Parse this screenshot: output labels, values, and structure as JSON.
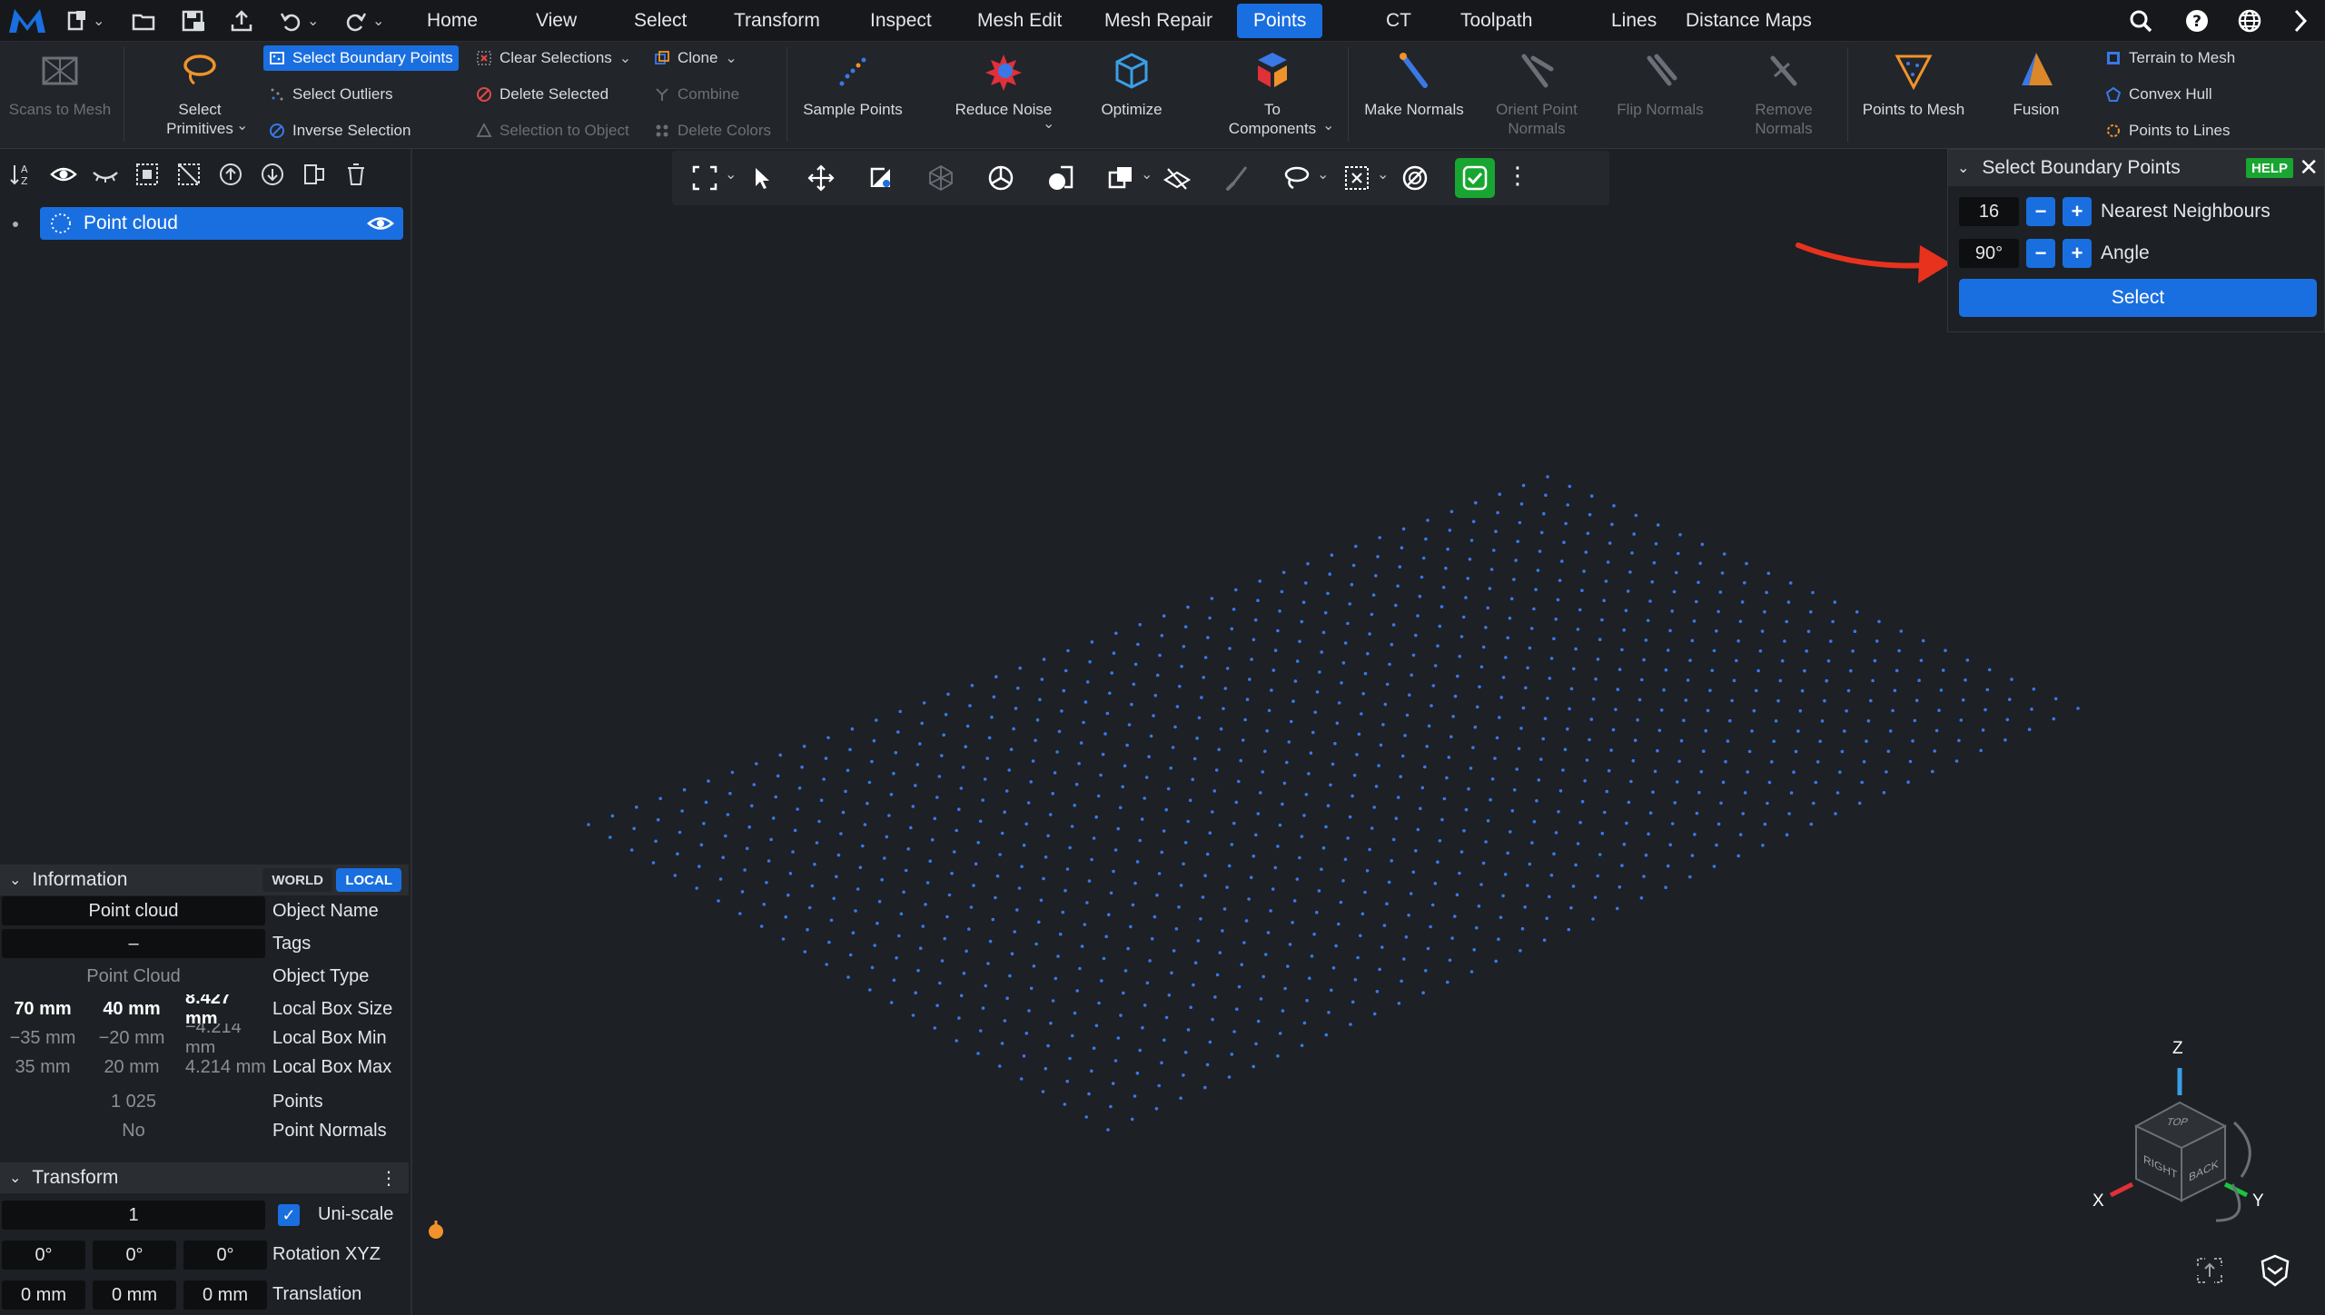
{
  "menubar": {
    "tabs": [
      "Home",
      "View",
      "Select",
      "Transform",
      "Inspect",
      "Mesh Edit",
      "Mesh Repair",
      "Points",
      "CT",
      "Toolpath",
      "Lines",
      "Distance Maps"
    ],
    "active_tab": "Points"
  },
  "ribbon": {
    "scans_to_mesh": "Scans to Mesh",
    "select_primitives": "Select Primitives",
    "select_boundary_points": "Select Boundary Points",
    "select_outliers": "Select Outliers",
    "inverse_selection": "Inverse Selection",
    "clear_selections": "Clear Selections",
    "delete_selected": "Delete Selected",
    "selection_to_object": "Selection to Object",
    "clone": "Clone",
    "combine": "Combine",
    "delete_colors": "Delete Colors",
    "sample_points": "Sample Points",
    "reduce_noise": "Reduce Noise",
    "optimize": "Optimize",
    "to_components": "To Components",
    "make_normals": "Make Normals",
    "orient_point_normals": "Orient Point Normals",
    "flip_normals": "Flip Normals",
    "remove_normals": "Remove Normals",
    "points_to_mesh": "Points to Mesh",
    "fusion": "Fusion",
    "terrain_to_mesh": "Terrain to Mesh",
    "convex_hull": "Convex Hull",
    "points_to_lines": "Points to Lines"
  },
  "scene": {
    "object_name": "Point cloud"
  },
  "information": {
    "title": "Information",
    "world": "WORLD",
    "local": "LOCAL",
    "object_name_value": "Point cloud",
    "object_name_label": "Object Name",
    "tags_value": "–",
    "tags_label": "Tags",
    "object_type_value": "Point Cloud",
    "object_type_label": "Object Type",
    "box_size": [
      "70 mm",
      "40 mm",
      "8.427 mm"
    ],
    "box_size_label": "Local Box Size",
    "box_min": [
      "−35 mm",
      "−20 mm",
      "−4.214 mm"
    ],
    "box_min_label": "Local Box Min",
    "box_max": [
      "35 mm",
      "20 mm",
      "4.214 mm"
    ],
    "box_max_label": "Local Box Max",
    "points_value": "1 025",
    "points_label": "Points",
    "normals_value": "No",
    "normals_label": "Point Normals"
  },
  "transform": {
    "title": "Transform",
    "scale": "1",
    "uniscale_label": "Uni-scale",
    "rotation": [
      "0°",
      "0°",
      "0°"
    ],
    "rotation_label": "Rotation XYZ",
    "translation": [
      "0 mm",
      "0 mm",
      "0 mm"
    ],
    "translation_label": "Translation"
  },
  "boundary_panel": {
    "title": "Select Boundary Points",
    "help": "HELP",
    "close": "✕",
    "neighbours_value": "16",
    "neighbours_label": "Nearest Neighbours",
    "angle_value": "90°",
    "angle_label": "Angle",
    "select_button": "Select",
    "minus": "−",
    "plus": "+"
  },
  "navcube": {
    "z": "Z",
    "x": "X",
    "y": "Y",
    "top": "TOP",
    "right": "RIGHT",
    "back": "BACK"
  },
  "colors": {
    "accent": "#1a6fe0",
    "success": "#19a531",
    "points": "#3a78e6",
    "annotation_arrow": "#e8321e"
  },
  "point_grid": {
    "rows": 25,
    "cols": 41
  }
}
